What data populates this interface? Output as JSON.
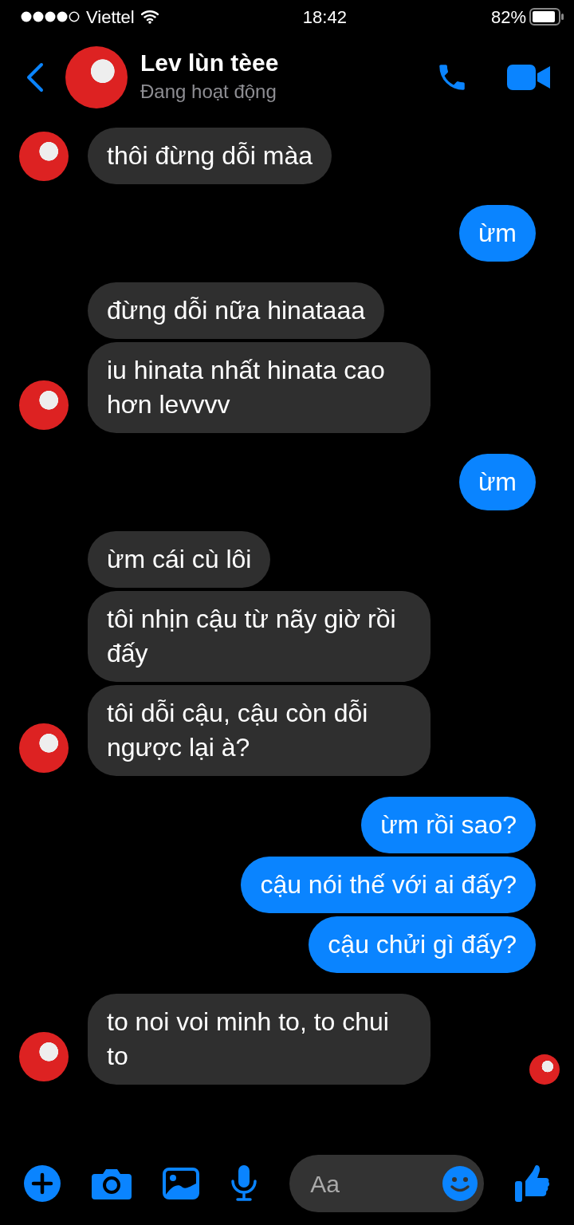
{
  "status_bar": {
    "carrier": "Viettel",
    "time": "18:42",
    "battery": "82%"
  },
  "header": {
    "name": "Lev lùn tèee",
    "status": "Đang hoạt động"
  },
  "groups": [
    {
      "kind": "incoming",
      "messages": [
        "thôi đừng dỗi màa"
      ]
    },
    {
      "kind": "outgoing",
      "messages": [
        "ừm"
      ]
    },
    {
      "kind": "incoming",
      "messages": [
        "đừng dỗi nữa hinataaa",
        "iu hinata nhất hinata cao hơn levvvv"
      ]
    },
    {
      "kind": "outgoing",
      "messages": [
        "ừm"
      ]
    },
    {
      "kind": "incoming",
      "messages": [
        "ừm cái cù lôi",
        "tôi nhịn cậu từ nãy giờ rồi đấy",
        "tôi dỗi cậu, cậu còn dỗi ngược lại à?"
      ]
    },
    {
      "kind": "outgoing",
      "messages": [
        "ừm rồi sao?",
        "cậu nói thế với ai đấy?",
        "cậu chửi gì đấy?"
      ]
    },
    {
      "kind": "incoming",
      "messages": [
        "to noi voi minh to, to chui to"
      ]
    }
  ],
  "seen": true,
  "composer": {
    "placeholder": "Aa"
  }
}
